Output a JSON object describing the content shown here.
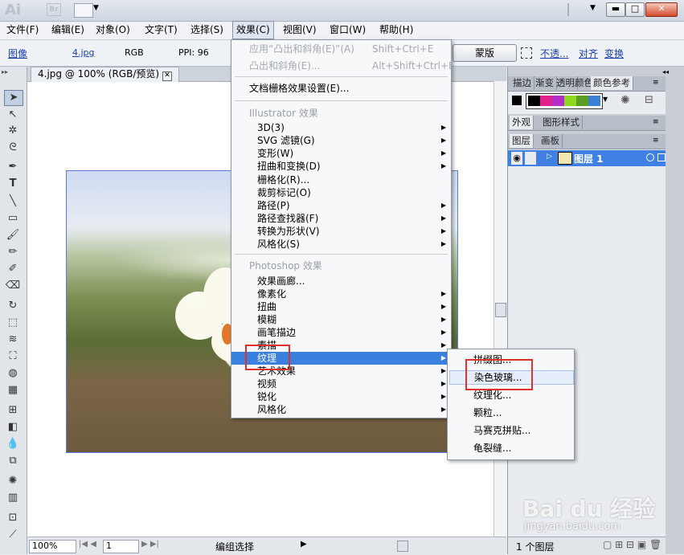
{
  "titlebar": {
    "app_logo": "Ai",
    "bridge_logo": "Br",
    "min": "▬",
    "max": "□",
    "close": "✕",
    "workspace_arrow": "▼"
  },
  "menubar": [
    "文件(F)",
    "编辑(E)",
    "对象(O)",
    "文字(T)",
    "选择(S)",
    "效果(C)",
    "视图(V)",
    "窗口(W)",
    "帮助(H)"
  ],
  "controlbar": {
    "image_label": "图像",
    "filename": "4.jpg",
    "color_mode": "RGB",
    "ppi": "PPI: 96",
    "mask_button": "蒙版",
    "opacity": "不透...",
    "align": "对齐",
    "transform": "变换"
  },
  "document": {
    "tab_title": "4.jpg @ 100% (RGB/预览)",
    "close": "✕"
  },
  "statusbar": {
    "zoom": "100%",
    "page": "1",
    "status": "编组选择"
  },
  "effect_menu": {
    "apply_last": {
      "label": "应用“凸出和斜角(E)”(A)",
      "shortcut": "Shift+Ctrl+E"
    },
    "last": {
      "label": "凸出和斜角(E)...",
      "shortcut": "Alt+Shift+Ctrl+E"
    },
    "raster_settings": "文档栅格效果设置(E)...",
    "illustrator_header": "Illustrator 效果",
    "illustrator_items": [
      "3D(3)",
      "SVG 滤镜(G)",
      "变形(W)",
      "扭曲和变换(D)",
      "栅格化(R)...",
      "裁剪标记(O)",
      "路径(P)",
      "路径查找器(F)",
      "转换为形状(V)",
      "风格化(S)"
    ],
    "photoshop_header": "Photoshop 效果",
    "photoshop_items": [
      "效果画廊...",
      "像素化",
      "扭曲",
      "模糊",
      "画笔描边",
      "素描",
      "纹理",
      "艺术效果",
      "视频",
      "锐化",
      "风格化"
    ]
  },
  "texture_submenu": [
    "拼缀图...",
    "染色玻璃...",
    "纹理化...",
    "颗粒...",
    "马赛克拼贴...",
    "龟裂缝..."
  ],
  "panels": {
    "row1_tabs": [
      "描边",
      "渐变",
      "透明",
      "颜色",
      "颜色参考"
    ],
    "row2_tabs": [
      "外观",
      "图形样式"
    ],
    "row3_tabs": [
      "图层",
      "画板"
    ],
    "layer_name": "图层 1",
    "layer_count": "1 个图层",
    "swatch_colors": [
      "#000000",
      "#e0218a",
      "#b52cc9",
      "#8cd91f",
      "#5a9f25",
      "#3b7fd6"
    ]
  },
  "watermark": {
    "brand": "Bai du 经验",
    "url": "jingyan.baidu.com"
  }
}
